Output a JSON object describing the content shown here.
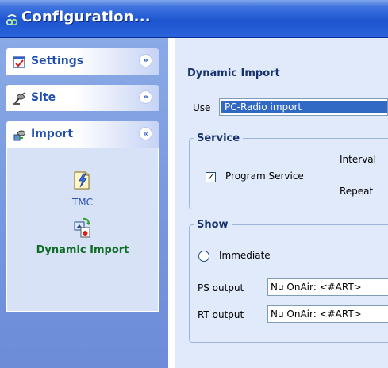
{
  "window": {
    "title": "Configuration..."
  },
  "sidebar": {
    "groups": [
      {
        "label": "Settings",
        "icon": "settings-icon",
        "chevron": "double-chevron-down"
      },
      {
        "label": "Site",
        "icon": "site-icon",
        "chevron": "double-chevron-down"
      },
      {
        "label": "Import",
        "icon": "import-icon",
        "chevron": "double-chevron-up"
      }
    ],
    "import_items": [
      {
        "label": "TMC",
        "icon": "tmc-icon"
      },
      {
        "label": "Dynamic Import",
        "icon": "dynamic-import-icon",
        "selected": true
      }
    ],
    "colors": {
      "active_item": "#0f6c24",
      "item": "#2b53b5",
      "header_text": "#1f4fb0"
    }
  },
  "panel": {
    "title": "Dynamic Import",
    "use_label": "Use",
    "use_value": "PC-Radio import",
    "service": {
      "legend": "Service",
      "program_service_label": "Program Service",
      "program_service_checked": true,
      "interval_label": "Interval",
      "repeat_label": "Repeat"
    },
    "show": {
      "legend": "Show",
      "immediate_label": "Immediate",
      "immediate_selected": false,
      "ps_output_label": "PS output",
      "ps_output_value": "Nu OnAir: <#ART>",
      "rt_output_label": "RT output",
      "rt_output_value": "Nu OnAir: <#ART>"
    }
  }
}
